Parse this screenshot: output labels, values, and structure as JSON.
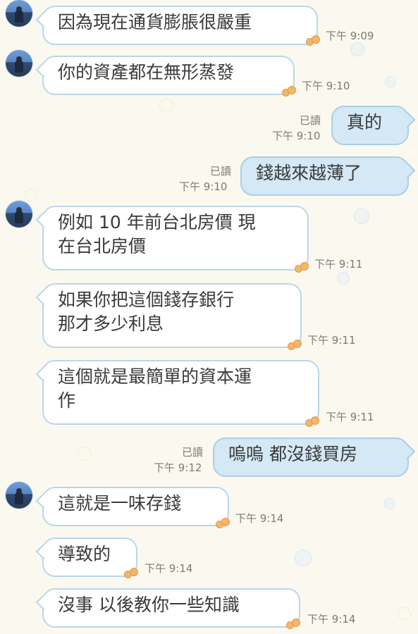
{
  "messages": [
    {
      "lines": [
        "因為現在通貨膨脹很嚴重"
      ],
      "time": "下午 9:09"
    },
    {
      "lines": [
        "你的資產都在無形蒸發"
      ],
      "time": "下午 9:10"
    },
    {
      "lines": [
        "真的"
      ],
      "time": "下午 9:10",
      "read": "已讀"
    },
    {
      "lines": [
        "錢越來越薄了"
      ],
      "time": "下午 9:10",
      "read": "已讀"
    },
    {
      "lines": [
        "例如 10 年前台北房價 現",
        "在台北房價"
      ],
      "time": "下午 9:11"
    },
    {
      "lines": [
        "如果你把這個錢存銀行",
        "那才多少利息"
      ],
      "time": "下午 9:11"
    },
    {
      "lines": [
        "這個就是最簡單的資本運",
        "作"
      ],
      "time": "下午 9:11"
    },
    {
      "lines": [
        "嗚嗚 都沒錢買房"
      ],
      "time": "下午 9:12",
      "read": "已讀"
    },
    {
      "lines": [
        "這就是一味存錢"
      ],
      "time": "下午 9:14"
    },
    {
      "lines": [
        "導致的"
      ],
      "time": "下午 9:14"
    },
    {
      "lines": [
        "沒事 以後教你一些知識"
      ],
      "time": "下午 9:14"
    }
  ],
  "icons": {
    "avatar": "user-avatar",
    "bubble_decoration": "cookie-decoration-icon"
  },
  "colors": {
    "background": "#fbf9ef",
    "incoming_bubble": "#ffffff",
    "outgoing_bubble": "#d4e8f5",
    "bubble_border": "#b9d6ea",
    "meta_text": "#7a7a7a"
  }
}
